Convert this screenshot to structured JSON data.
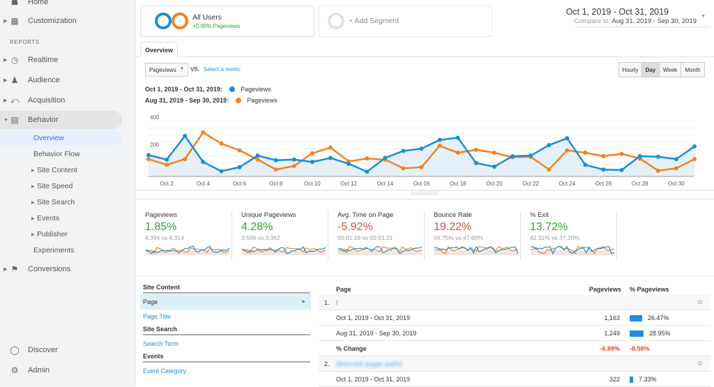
{
  "sidebar": {
    "top_items": [
      {
        "label": "Home",
        "icon": "home-icon"
      },
      {
        "label": "Customization",
        "icon": "grid-icon"
      }
    ],
    "section_label": "REPORTS",
    "report_items": [
      {
        "label": "Realtime",
        "icon": "clock-icon"
      },
      {
        "label": "Audience",
        "icon": "person-icon"
      },
      {
        "label": "Acquisition",
        "icon": "acquisition-icon"
      },
      {
        "label": "Behavior",
        "icon": "behavior-icon"
      }
    ],
    "behavior_sub": [
      {
        "label": "Overview",
        "expandable": false,
        "selected": true
      },
      {
        "label": "Behavior Flow",
        "expandable": false
      },
      {
        "label": "Site Content",
        "expandable": true
      },
      {
        "label": "Site Speed",
        "expandable": true
      },
      {
        "label": "Site Search",
        "expandable": true
      },
      {
        "label": "Events",
        "expandable": true
      },
      {
        "label": "Publisher",
        "expandable": true
      },
      {
        "label": "Experiments",
        "expandable": false
      }
    ],
    "conversions": {
      "label": "Conversions",
      "icon": "flag-icon"
    },
    "bottom_items": [
      {
        "label": "Discover",
        "icon": "lightbulb-icon"
      },
      {
        "label": "Admin",
        "icon": "gear-icon"
      }
    ]
  },
  "segments": {
    "active": {
      "name": "All Users",
      "sub": "+0.00% Pageviews"
    },
    "add_label": "+ Add Segment"
  },
  "date_range": {
    "main": "Oct 1, 2019 - Oct 31, 2019",
    "compare_prefix": "Compare to:",
    "compare": "Aug 31, 2019 - Sep 30, 2019"
  },
  "tabs": [
    {
      "label": "Overview"
    }
  ],
  "chart_controls": {
    "metric": "Pageviews",
    "vs": "VS.",
    "select_metric": "Select a metric",
    "granularity": [
      "Hourly",
      "Day",
      "Week",
      "Month"
    ],
    "selected_granularity": "Day"
  },
  "colors": {
    "current": "#1a8fd1",
    "previous": "#f0831f",
    "green": "#2fa12f",
    "red": "#d64d34"
  },
  "chart_data": {
    "type": "line",
    "legend": [
      {
        "range": "Oct 1, 2019 - Oct 31, 2019:",
        "name": "Pageviews"
      },
      {
        "range": "Aug 31, 2019 - Sep 30, 2019:",
        "name": "Pageviews"
      }
    ],
    "x": [
      "Oct 1",
      "Oct 2",
      "Oct 3",
      "Oct 4",
      "Oct 5",
      "Oct 6",
      "Oct 7",
      "Oct 8",
      "Oct 9",
      "Oct 10",
      "Oct 11",
      "Oct 12",
      "Oct 13",
      "Oct 14",
      "Oct 15",
      "Oct 16",
      "Oct 17",
      "Oct 18",
      "Oct 19",
      "Oct 20",
      "Oct 21",
      "Oct 22",
      "Oct 23",
      "Oct 24",
      "Oct 25",
      "Oct 26",
      "Oct 27",
      "Oct 28",
      "Oct 29",
      "Oct 30",
      "Oct 31"
    ],
    "x_tick_labels": [
      "Oct 2",
      "Oct 4",
      "Oct 6",
      "Oct 8",
      "Oct 10",
      "Oct 12",
      "Oct 14",
      "Oct 16",
      "Oct 18",
      "Oct 20",
      "Oct 22",
      "Oct 24",
      "Oct 26",
      "Oct 28",
      "Oct 30"
    ],
    "y_tick_labels": [
      "200",
      "400"
    ],
    "ylim": [
      0,
      400
    ],
    "grid": true,
    "series": [
      {
        "name": "Pageviews (Oct 1, 2019 - Oct 31, 2019)",
        "values": [
          155,
          122,
          294,
          105,
          38,
          67,
          151,
          118,
          122,
          105,
          134,
          92,
          34,
          134,
          185,
          202,
          265,
          281,
          97,
          71,
          147,
          151,
          227,
          277,
          84,
          50,
          46,
          147,
          143,
          126,
          218
        ]
      },
      {
        "name": "Pageviews (Aug 31, 2019 - Sep 30, 2019)",
        "values": [
          126,
          84,
          126,
          319,
          239,
          189,
          122,
          50,
          76,
          168,
          210,
          109,
          130,
          122,
          59,
          67,
          223,
          172,
          193,
          172,
          139,
          143,
          50,
          189,
          172,
          147,
          164,
          130,
          42,
          59,
          126
        ]
      }
    ]
  },
  "metrics": [
    {
      "title": "Pageviews",
      "change": "1.85%",
      "trend": "green",
      "compare": "4,394 vs 4,314"
    },
    {
      "title": "Unique Pageviews",
      "change": "4.28%",
      "trend": "green",
      "compare": "3,506 vs 3,362"
    },
    {
      "title": "Avg. Time on Page",
      "change": "-5.92%",
      "trend": "red",
      "compare": "00:01:16 vs 00:01:21"
    },
    {
      "title": "Bounce Rate",
      "change": "19.22%",
      "trend": "red",
      "compare": "56.75% vs 47.60%"
    },
    {
      "title": "% Exit",
      "change": "13.72%",
      "trend": "green",
      "compare": "42.31% vs 37.20%"
    }
  ],
  "left_table": {
    "sections": [
      {
        "header": "Site Content",
        "items": [
          "Page",
          "Page Title"
        ]
      },
      {
        "header": "Site Search",
        "items": [
          "Search Term"
        ]
      },
      {
        "header": "Events",
        "items": [
          "Event Category"
        ]
      }
    ],
    "selected": "Page"
  },
  "right_table": {
    "headers": {
      "page": "Page",
      "pageviews": "Pageviews",
      "pct": "% Pageviews"
    },
    "rows": [
      {
        "type": "page",
        "index": "1.",
        "page": "/"
      },
      {
        "type": "data",
        "label": "Oct 1, 2019 - Oct 31, 2019",
        "pageviews": "1,163",
        "pct": "26.47%",
        "share": 26.47
      },
      {
        "type": "data",
        "label": "Aug 31, 2019 - Sep 30, 2019",
        "pageviews": "1,249",
        "pct": "28.95%",
        "share": 28.95
      },
      {
        "type": "change",
        "label": "% Change",
        "pageviews": "-6.89%",
        "pct": "-8.58%"
      },
      {
        "type": "page",
        "index": "2.",
        "page": "(blurred page path)"
      },
      {
        "type": "data",
        "label": "Oct 1, 2019 - Oct 31, 2019",
        "pageviews": "322",
        "pct": "7.33%",
        "share": 7.33
      }
    ]
  }
}
